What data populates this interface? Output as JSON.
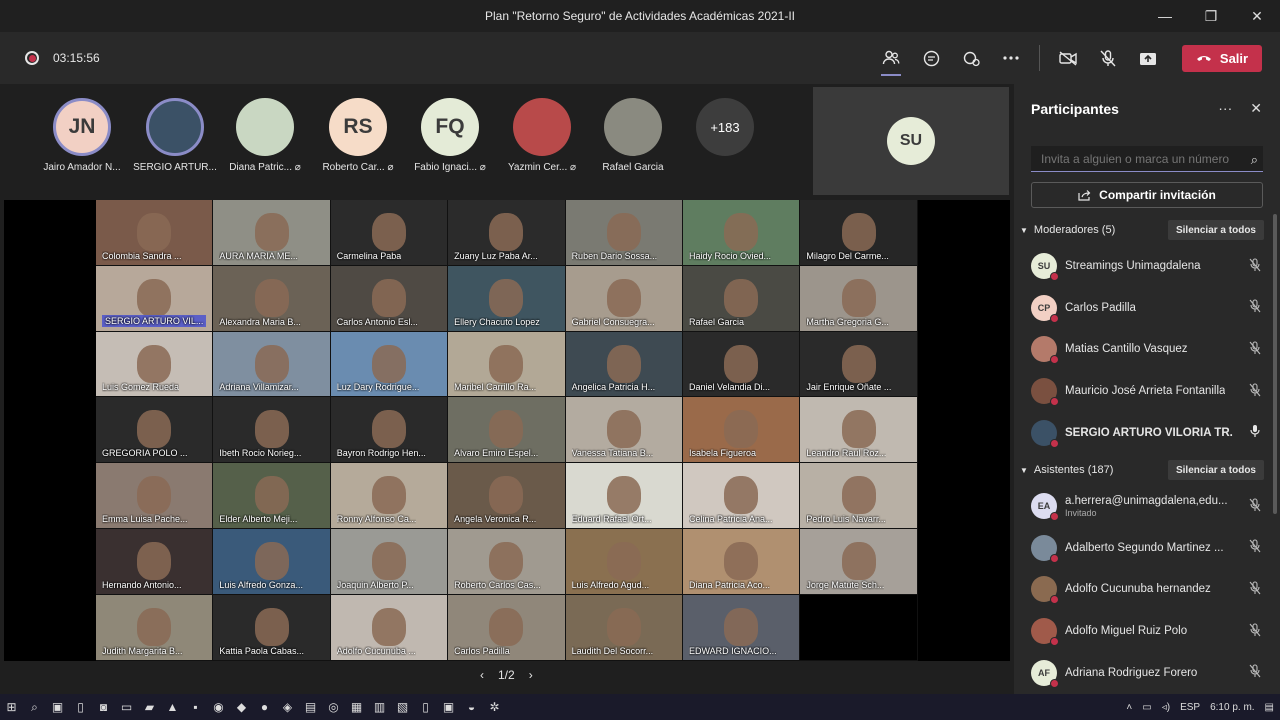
{
  "window": {
    "title": "Plan \"Retorno Seguro\" de Actividades Académicas 2021-II",
    "minimize": "—",
    "maximize": "❐",
    "close": "✕"
  },
  "toolbar": {
    "timer": "03:15:56",
    "leave_label": "Salir"
  },
  "strip": [
    {
      "initials": "JN",
      "name": "Jairo Amador N...",
      "bg": "#f2d0c4",
      "ring": true
    },
    {
      "initials": "",
      "name": "SERGIO ARTUR...",
      "bg": "#3b5166",
      "ring": true
    },
    {
      "initials": "",
      "name": "Diana Patric...",
      "bg": "#c9d7c2",
      "ring": false,
      "mic": true
    },
    {
      "initials": "RS",
      "name": "Roberto Car...",
      "bg": "#f6dcc8",
      "ring": false,
      "mic": true
    },
    {
      "initials": "FQ",
      "name": "Fabio Ignaci...",
      "bg": "#e4ebd7",
      "ring": false,
      "mic": true
    },
    {
      "initials": "",
      "name": "Yazmin Cer...",
      "bg": "#b84a4a",
      "ring": false,
      "mic": true
    },
    {
      "initials": "",
      "name": "Rafael Garcia",
      "bg": "#8a8a80",
      "ring": false
    },
    {
      "initials": "+183",
      "name": "",
      "bg": "#3d3d3d",
      "ring": false,
      "more": true
    }
  ],
  "spotlight": {
    "initials": "SU"
  },
  "grid": [
    {
      "name": "Colombia Sandra ...",
      "bg": "#7a5a4a"
    },
    {
      "name": "AURA MARIA ME...",
      "bg": "#8f8f86"
    },
    {
      "name": "Carmelina Paba",
      "bg": "#2b2b2b"
    },
    {
      "name": "Zuany Luz Paba Ar...",
      "bg": "#2b2b2b"
    },
    {
      "name": "Ruben Dario Sossa...",
      "bg": "#7a7a72"
    },
    {
      "name": "Haidy Rocio Ovied...",
      "bg": "#5f7d60"
    },
    {
      "name": "Milagro Del Carme...",
      "bg": "#262626"
    },
    {
      "name": "SERGIO ARTURO VIL...",
      "bg": "#b7a89a",
      "hl": true
    },
    {
      "name": "Alexandra Maria B...",
      "bg": "#6b6256"
    },
    {
      "name": "Carlos Antonio Esl...",
      "bg": "#4f4a44"
    },
    {
      "name": "Ellery Chacuto Lopez",
      "bg": "#3f5560"
    },
    {
      "name": "Gabriel Consuegra...",
      "bg": "#a79c8e"
    },
    {
      "name": "Rafael Garcia",
      "bg": "#4a4a44"
    },
    {
      "name": "Martha Gregoria G...",
      "bg": "#9c958c"
    },
    {
      "name": "Luis Gomez Rueda",
      "bg": "#c5bdb5"
    },
    {
      "name": "Adriana Villamizar...",
      "bg": "#7f8fa0"
    },
    {
      "name": "Luz Dary Rodrigue...",
      "bg": "#6a8cb0"
    },
    {
      "name": "Maribel Carrillo Ra...",
      "bg": "#b2a896"
    },
    {
      "name": "Angelica Patricia H...",
      "bg": "#3e4a52"
    },
    {
      "name": "Daniel Velandia Di...",
      "bg": "#2a2a2a"
    },
    {
      "name": "Jair Enrique Oñate ...",
      "bg": "#2a2a2a"
    },
    {
      "name": "GREGORIA POLO ...",
      "bg": "#2a2a2a"
    },
    {
      "name": "Ibeth Rocio Norieg...",
      "bg": "#2a2a2a"
    },
    {
      "name": "Bayron Rodrigo Hen...",
      "bg": "#2a2a2a"
    },
    {
      "name": "Alvaro Emiro Espel...",
      "bg": "#6e6e62"
    },
    {
      "name": "Vanessa Tatiana B...",
      "bg": "#b3aba0"
    },
    {
      "name": "Isabela Figueroa",
      "bg": "#9a6a4a"
    },
    {
      "name": "Leandro Raul Roz...",
      "bg": "#c0b9b0"
    },
    {
      "name": "Emma Luisa Pache...",
      "bg": "#8a7a70"
    },
    {
      "name": "Elder Alberto Meji...",
      "bg": "#55604a"
    },
    {
      "name": "Ronny Alfonso Ca...",
      "bg": "#b5aa9a"
    },
    {
      "name": "Angela Veronica R...",
      "bg": "#6a5a4a"
    },
    {
      "name": "Eduard Rafael Ort...",
      "bg": "#d9d9d0"
    },
    {
      "name": "Celina Patricia Ana...",
      "bg": "#d0c8c0"
    },
    {
      "name": "Pedro Luis Navarr...",
      "bg": "#b8b0a5"
    },
    {
      "name": "Hernando Antonio...",
      "bg": "#3a3030"
    },
    {
      "name": "Luis Alfredo Gonza...",
      "bg": "#3a5a7a"
    },
    {
      "name": "Joaquin Alberto P...",
      "bg": "#9a9a95"
    },
    {
      "name": "Roberto Carlos Cas...",
      "bg": "#a09a90"
    },
    {
      "name": "Luis Alfredo Agud...",
      "bg": "#8a7050"
    },
    {
      "name": "Diana Patricia Aco...",
      "bg": "#b09070"
    },
    {
      "name": "Jorge Matute Sch...",
      "bg": "#a6a099"
    },
    {
      "name": "Judith Margarita B...",
      "bg": "#8f8878"
    },
    {
      "name": "Kattia Paola Cabas...",
      "bg": "#2a2a2a"
    },
    {
      "name": "Adolfo Cucunuba ...",
      "bg": "#c0b8b0"
    },
    {
      "name": "Carlos Padilla",
      "bg": "#90877a"
    },
    {
      "name": "Laudith Del Socorr...",
      "bg": "#7a6a55"
    },
    {
      "name": "EDWARD IGNACIO...",
      "bg": "#5a5f6a"
    },
    {
      "name": "",
      "bg": "#000000"
    }
  ],
  "pager": {
    "prev": "‹",
    "page": "1/2",
    "next": "›"
  },
  "panel": {
    "title": "Participantes",
    "invite_placeholder": "Invita a alguien o marca un número",
    "share_label": "Compartir invitación",
    "moderators_label": "Moderadores (5)",
    "attendees_label": "Asistentes (187)",
    "mute_all_label": "Silenciar a todos",
    "moderators": [
      {
        "name": "Streamings Unimagdalena",
        "initials": "SU",
        "bg": "#e6ecd8",
        "muted": true
      },
      {
        "name": "Carlos Padilla",
        "initials": "CP",
        "bg": "#f2d0c4",
        "muted": true
      },
      {
        "name": "Matias Cantillo Vasquez",
        "initials": "",
        "bg": "#b47a6a",
        "muted": true
      },
      {
        "name": "Mauricio José Arrieta Fontanilla",
        "initials": "",
        "bg": "#7a5040",
        "muted": true
      },
      {
        "name": "SERGIO ARTURO VILORIA TR...",
        "initials": "",
        "bg": "#3b5166",
        "muted": false,
        "bold": true
      }
    ],
    "attendees": [
      {
        "name": "a.herrera@unimagdalena,edu...",
        "sub": "Invitado",
        "initials": "EA",
        "bg": "#dcdcf0",
        "muted": true
      },
      {
        "name": "Adalberto Segundo Martinez ...",
        "sub": "",
        "initials": "",
        "bg": "#7a8a9a",
        "muted": true
      },
      {
        "name": "Adolfo Cucunuba hernandez",
        "sub": "",
        "initials": "",
        "bg": "#8a6a50",
        "muted": true
      },
      {
        "name": "Adolfo Miguel Ruiz Polo",
        "sub": "",
        "initials": "",
        "bg": "#a05a4a",
        "muted": true
      },
      {
        "name": "Adriana Rodriguez Forero",
        "sub": "",
        "initials": "AF",
        "bg": "#e6ecd8",
        "muted": true
      }
    ]
  },
  "taskbar": {
    "lang": "ESP",
    "time": "6:10 p. m."
  }
}
